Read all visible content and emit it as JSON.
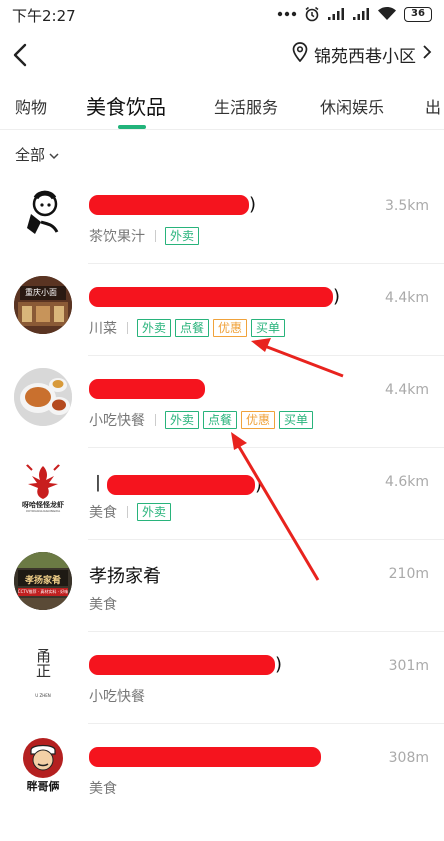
{
  "status": {
    "time": "下午2:27",
    "battery": "36"
  },
  "nav": {
    "location": "锦苑西巷小区"
  },
  "tabs": [
    {
      "label": "购物"
    },
    {
      "label": "美食饮品"
    },
    {
      "label": "生活服务"
    },
    {
      "label": "休闲娱乐"
    },
    {
      "label": "出"
    }
  ],
  "filter": {
    "label": "全部"
  },
  "items": [
    {
      "name_visible": ")",
      "distance": "3.5km",
      "category": "茶饮果汁",
      "tags": [
        "外卖"
      ],
      "logo_text": ""
    },
    {
      "name_visible": ")",
      "distance": "4.4km",
      "category": "川菜",
      "tags": [
        "外卖",
        "点餐",
        "优惠",
        "买单"
      ],
      "logo_text": "重庆小面"
    },
    {
      "name_visible": "",
      "distance": "4.4km",
      "category": "小吃快餐",
      "tags": [
        "外卖",
        "点餐",
        "优惠",
        "买单"
      ],
      "logo_text": ""
    },
    {
      "name_visible": "丨",
      "name_trail": ")",
      "distance": "4.6km",
      "category": "美食",
      "tags": [
        "外卖"
      ],
      "logo_text": "呀哈怪怪龙虾",
      "logo_subtext": "XUYOUAIGUAILONGXIA"
    },
    {
      "name_visible": "孝扬家肴",
      "distance": "210m",
      "category": "美食",
      "tags": [],
      "logo_text": "孝扬家肴",
      "logo_subtext": "CCTV推荐 · 真材实料 · 好味"
    },
    {
      "name_visible": ")",
      "distance": "301m",
      "category": "小吃快餐",
      "tags": [],
      "logo_text": "甬正",
      "logo_subtext": "U ZHEN"
    },
    {
      "name_visible": "",
      "distance": "308m",
      "category": "美食",
      "tags": [],
      "logo_text": "胖哥俩"
    }
  ]
}
